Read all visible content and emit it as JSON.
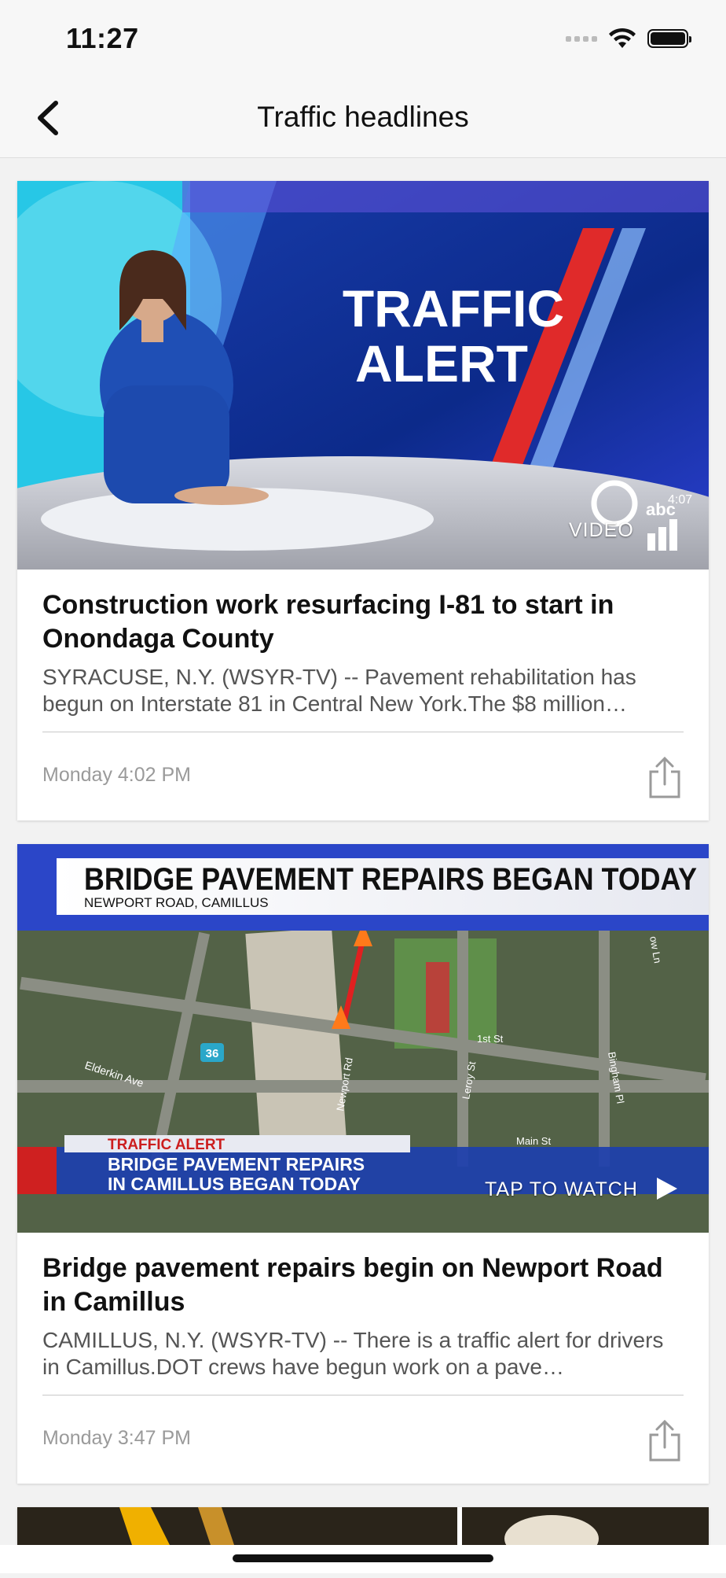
{
  "status": {
    "time": "11:27"
  },
  "header": {
    "title": "Traffic headlines"
  },
  "articles": [
    {
      "media_label": "VIDEO",
      "thumb_text_1": "TRAFFIC",
      "thumb_text_2": "ALERT",
      "thumb_clock": "4:07",
      "title": "Construction work resurfacing I-81 to start in Onondaga County",
      "summary": "SYRACUSE, N.Y. (WSYR-TV) -- Pavement rehabilitation has begun on Interstate 81 in Central New York.The $8 million…",
      "time": "Monday 4:02 PM"
    },
    {
      "media_label": "TAP TO WATCH",
      "thumb_headline": "BRIDGE PAVEMENT REPAIRS BEGAN TODAY",
      "thumb_subhead": "NEWPORT ROAD, CAMILLUS",
      "thumb_alert": "TRAFFIC ALERT",
      "thumb_lower_1": "BRIDGE PAVEMENT REPAIRS",
      "thumb_lower_2": "IN CAMILLUS BEGAN TODAY",
      "map_labels": [
        "Elderkin Ave",
        "36",
        "Newport Rd",
        "Leroy St",
        "1st St",
        "Main St",
        "Bingham Pl",
        "ow Ln"
      ],
      "title": "Bridge pavement repairs begin on Newport Road in Camillus",
      "summary": "CAMILLUS, N.Y. (WSYR-TV) -- There is a traffic alert for drivers in Camillus.DOT crews have begun work on a pave…",
      "time": "Monday 3:47 PM"
    }
  ],
  "icons": [
    "back-chevron-icon",
    "wifi-icon",
    "battery-icon",
    "share-icon",
    "play-icon",
    "signal-bars-icon"
  ]
}
